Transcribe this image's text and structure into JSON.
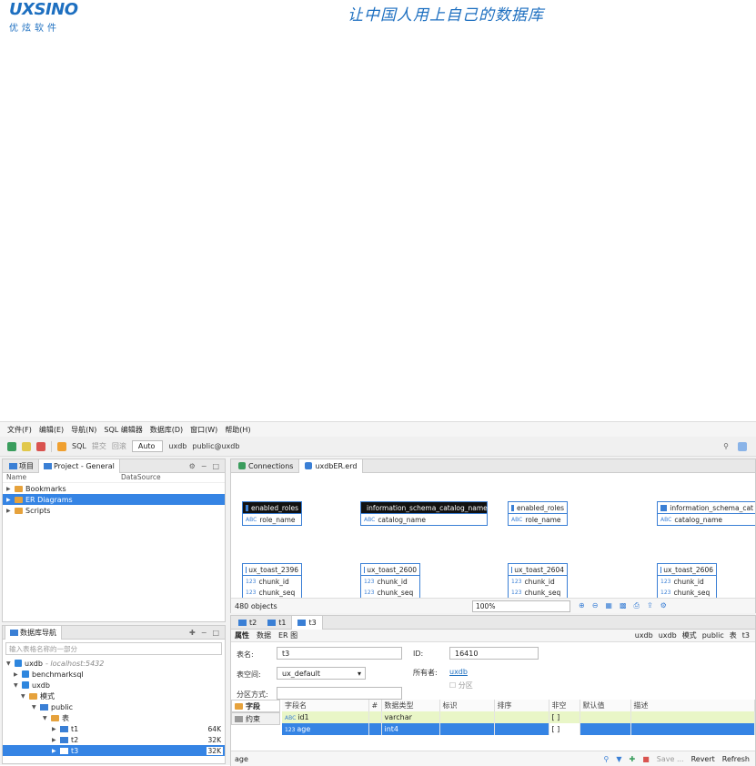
{
  "logo": {
    "brand": "UXSINO",
    "sub": "优炫软件"
  },
  "slogan": "让中国人用上自己的数据库",
  "menu": [
    "文件(F)",
    "编辑(E)",
    "导航(N)",
    "SQL 编辑器",
    "数据库(D)",
    "窗口(W)",
    "帮助(H)"
  ],
  "toolbar": {
    "sql": "SQL",
    "commit": "提交",
    "rollback": "回滚",
    "auto": "Auto",
    "datasource": "uxdb",
    "schema": "public@uxdb"
  },
  "project_panel": {
    "tab_project": "项目",
    "tab_general": "Project - General",
    "col_name": "Name",
    "col_datasource": "DataSource",
    "items": [
      "Bookmarks",
      "ER Diagrams",
      "Scripts"
    ]
  },
  "nav_panel": {
    "title": "数据库导航",
    "search_placeholder": "输入表格名称的一部分",
    "tree": [
      {
        "label": "uxdb",
        "extra": " - localhost:5432"
      },
      {
        "label": "benchmarksql"
      },
      {
        "label": "uxdb"
      },
      {
        "label": "模式"
      },
      {
        "label": "public"
      },
      {
        "label": "表"
      },
      {
        "label": "t1",
        "size": "64K"
      },
      {
        "label": "t2",
        "size": "32K"
      },
      {
        "label": "t3",
        "size": "32K"
      }
    ]
  },
  "er_editor": {
    "tab_connections": "Connections",
    "tab_erd": "uxdbER.erd",
    "entities": [
      {
        "name": "enabled_roles",
        "attr": "role_name",
        "type": "ABC",
        "dark": true
      },
      {
        "name": "information_schema_catalog_name",
        "attr": "catalog_name",
        "type": "ABC",
        "dark": true
      },
      {
        "name": "enabled_roles",
        "attr": "role_name",
        "type": "ABC",
        "dark": false
      },
      {
        "name": "information_schema_cat",
        "attr": "catalog_name",
        "type": "ABC",
        "dark": false
      },
      {
        "name": "ux_toast_2396",
        "attr": "chunk_id",
        "attr2": "chunk_seq",
        "type": "123"
      },
      {
        "name": "ux_toast_2600",
        "attr": "chunk_id",
        "attr2": "chunk_seq",
        "type": "123"
      },
      {
        "name": "ux_toast_2604",
        "attr": "chunk_id",
        "attr2": "chunk_seq",
        "type": "123"
      },
      {
        "name": "ux_toast_2606",
        "attr": "chunk_id",
        "attr2": "chunk_seq",
        "type": "123"
      }
    ],
    "object_count": "480 objects",
    "zoom": "100%"
  },
  "table_editor": {
    "tabs": [
      "t2",
      "t1",
      "t3"
    ],
    "subtabs": [
      "属性",
      "数据",
      "ER 图"
    ],
    "crumb": [
      "uxdb",
      "uxdb",
      "模式",
      "public",
      "表",
      "t3"
    ],
    "labels": {
      "table_name": "表名:",
      "tablespace": "表空间:",
      "partition": "分区方式:",
      "id": "ID:",
      "owner": "所有者:",
      "partition_chk": "分区"
    },
    "values": {
      "table_name": "t3",
      "tablespace": "ux_default",
      "id": "16410",
      "owner": "uxdb"
    },
    "side_tabs": [
      "字段",
      "约束"
    ],
    "columns": [
      "字段名",
      "#",
      "数据类型",
      "标识",
      "排序",
      "非空",
      "默认值",
      "描述"
    ],
    "rows": [
      {
        "name": "id1",
        "type": "varchar",
        "notnull": "[ ]"
      },
      {
        "name": "age",
        "type": "int4",
        "notnull": "[ ]"
      }
    ],
    "status_text": "age",
    "save": "Save ...",
    "revert": "Revert",
    "refresh": "Refresh"
  }
}
